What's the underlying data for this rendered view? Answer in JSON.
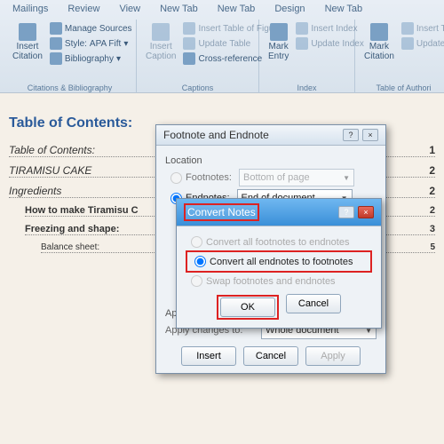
{
  "tabs": [
    "Mailings",
    "Review",
    "View",
    "New Tab",
    "New Tab",
    "Design",
    "New Tab"
  ],
  "ribbon": {
    "citations": {
      "label": "Citations & Bibliography",
      "insert_citation": "Insert\nCitation",
      "manage": "Manage Sources",
      "style_label": "Style:",
      "style_value": "APA Fift",
      "biblio": "Bibliography"
    },
    "captions": {
      "label": "Captions",
      "insert_caption": "Insert\nCaption",
      "figures": "Insert Table of Figures",
      "update_table": "Update Table",
      "cross": "Cross-reference"
    },
    "index": {
      "label": "Index",
      "mark_entry": "Mark\nEntry",
      "insert_index": "Insert Index",
      "update_index": "Update Index"
    },
    "toa": {
      "label": "Table of Authori",
      "mark_citation": "Mark\nCitation",
      "insert_toa": "Insert Tabl",
      "update_table": "Update Tabl"
    }
  },
  "doc": {
    "title": "Table of Contents:",
    "rows": [
      {
        "t": "Table of Contents:",
        "p": "1",
        "lvl": 1
      },
      {
        "t": "TIRAMISU CAKE",
        "p": "2",
        "lvl": 1
      },
      {
        "t": "Ingredients",
        "p": "2",
        "lvl": 1
      },
      {
        "t": "How to make Tiramisu C",
        "p": "2",
        "lvl": 2
      },
      {
        "t": "Freezing and shape:",
        "p": "3",
        "lvl": 2
      },
      {
        "t": "Balance sheet:",
        "p": "5",
        "lvl": 3
      }
    ]
  },
  "d1": {
    "title": "Footnote and Endnote",
    "location": "Location",
    "footnotes": "Footnotes:",
    "footnotes_val": "Bottom of page",
    "endnotes": "Endnotes:",
    "endnotes_val": "End of document",
    "format": "Form",
    "num": "Nu",
    "cust": "Cu",
    "start": "St",
    "numb": "Nu",
    "apply": "Apply changes",
    "apply_to": "Apply changes to:",
    "apply_val": "Whole document",
    "insert": "Insert",
    "cancel": "Cancel",
    "apply_btn": "Apply"
  },
  "d2": {
    "title": "Convert Notes",
    "opt1": "Convert all footnotes to endnotes",
    "opt2": "Convert all endnotes to footnotes",
    "opt3": "Swap footnotes and endnotes",
    "ok": "OK",
    "cancel": "Cancel"
  }
}
